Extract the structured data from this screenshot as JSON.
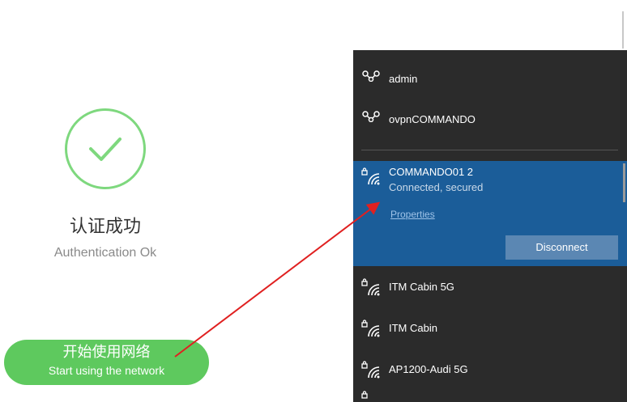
{
  "auth_page": {
    "title": "认证成功",
    "subtitle": "Authentication Ok",
    "start_button": {
      "label_cn": "开始使用网络",
      "label_en": "Start using the network"
    }
  },
  "wifi_flyout": {
    "vpn_connections": [
      {
        "name": "admin",
        "icon": "vpn-icon"
      },
      {
        "name": "ovpnCOMMANDO",
        "icon": "vpn-icon"
      }
    ],
    "connected_network": {
      "ssid": "COMMANDO01 2",
      "status": "Connected, secured",
      "properties_label": "Properties",
      "disconnect_label": "Disconnect",
      "icon": "wifi-secured-icon"
    },
    "networks": [
      {
        "ssid": "ITM Cabin 5G",
        "icon": "wifi-secured-icon"
      },
      {
        "ssid": "ITM Cabin",
        "icon": "wifi-secured-icon"
      },
      {
        "ssid": "AP1200-Audi 5G",
        "icon": "wifi-secured-icon"
      }
    ]
  },
  "colors": {
    "check_green": "#7ed87e",
    "button_green": "#5ec95e",
    "flyout_bg": "#2b2b2b",
    "selected_bg": "#1b5d99",
    "annotation_arrow": "#e02020"
  }
}
